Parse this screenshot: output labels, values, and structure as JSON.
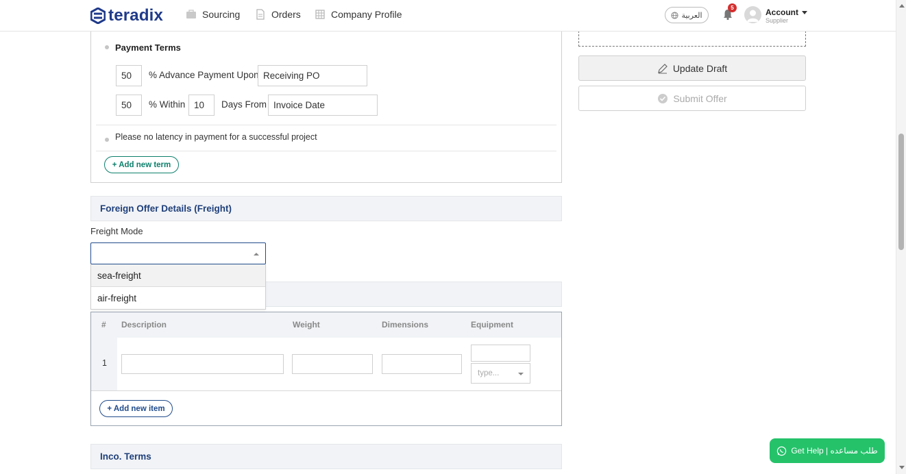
{
  "brand": {
    "name": "teradix",
    "color": "#1f3a8a"
  },
  "nav": {
    "items": [
      {
        "label": "Sourcing",
        "icon": "briefcase-icon"
      },
      {
        "label": "Orders",
        "icon": "document-icon"
      },
      {
        "label": "Company Profile",
        "icon": "building-icon"
      }
    ],
    "language_label": "العربية",
    "notification_count": "5",
    "account_label": "Account",
    "account_role": "Supplier"
  },
  "payment_terms": {
    "heading": "Payment Terms",
    "advance": {
      "percent": "50",
      "text": "% Advance Payment Upon",
      "event": "Receiving PO"
    },
    "within": {
      "percent": "50",
      "text": "% Within",
      "days": "10",
      "days_text": "Days From",
      "event": "Invoice Date"
    },
    "note": "Please no latency in payment for a successful project",
    "add_term_label": "+ Add new term"
  },
  "freight": {
    "section_title": "Foreign Offer Details (Freight)",
    "mode_label": "Freight Mode",
    "mode_value": "",
    "options": [
      "sea-freight",
      "air-freight"
    ]
  },
  "items_table": {
    "headers": [
      "#",
      "Description",
      "Weight",
      "Dimensions",
      "Equipment"
    ],
    "rows": [
      {
        "num": "1",
        "description": "",
        "weight": "",
        "dimensions": "",
        "equipment_qty": "",
        "equipment_type_placeholder": "type..."
      }
    ],
    "add_item_label": "+ Add new item"
  },
  "inco_terms": {
    "section_title": "Inco. Terms"
  },
  "actions": {
    "update_draft_label": "Update Draft",
    "submit_offer_label": "Submit Offer"
  },
  "help": {
    "label": "Get Help | طلب مساعده"
  },
  "colors": {
    "accent_blue": "#1f4a8a",
    "accent_green": "#0c7f6b",
    "whatsapp_green": "#25c26a",
    "badge_red": "#d32f2f"
  }
}
